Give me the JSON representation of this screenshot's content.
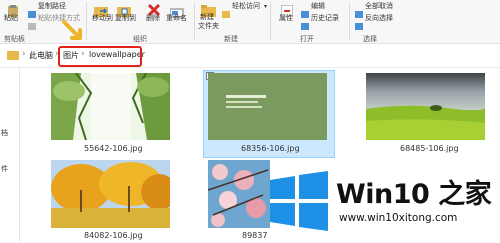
{
  "ribbon": {
    "clipboard": {
      "paste": "粘贴",
      "copy_path": "复制路径",
      "paste_shortcut": "粘贴快捷方式",
      "group_label": "剪贴板"
    },
    "organize": {
      "move_to": "移动到",
      "copy_to": "复制到",
      "delete": "删除",
      "rename": "重命名",
      "group_label": "组织"
    },
    "new": {
      "new_folder_line1": "新建",
      "new_folder_line2": "文件夹",
      "easy_access": "轻松访问",
      "group_label": "新建"
    },
    "open": {
      "properties": "属性",
      "edit": "编辑",
      "history": "历史记录",
      "group_label": "打开"
    },
    "select": {
      "select_all": "全部取消",
      "invert": "反向选择",
      "group_label": "选择"
    }
  },
  "address_bar": {
    "crumbs": [
      "此电脑",
      "图片",
      "lovewallpaper"
    ],
    "separator": "›"
  },
  "left_nav": {
    "chars": [
      "档",
      "件"
    ]
  },
  "files": [
    {
      "name": "55642-106.jpg",
      "selected": false
    },
    {
      "name": "68356-106.jpg",
      "selected": true
    },
    {
      "name": "68485-106.jpg",
      "selected": false
    },
    {
      "name": "84082-106.jpg",
      "selected": false
    },
    {
      "name": "89837",
      "selected": false
    }
  ],
  "watermark": {
    "title": "Win10 之家",
    "url": "www.win10xitong.com"
  },
  "colors": {
    "selection_bg": "#cce8ff",
    "highlight_box": "#e0241b",
    "logo_blue": "#1e90e6"
  }
}
